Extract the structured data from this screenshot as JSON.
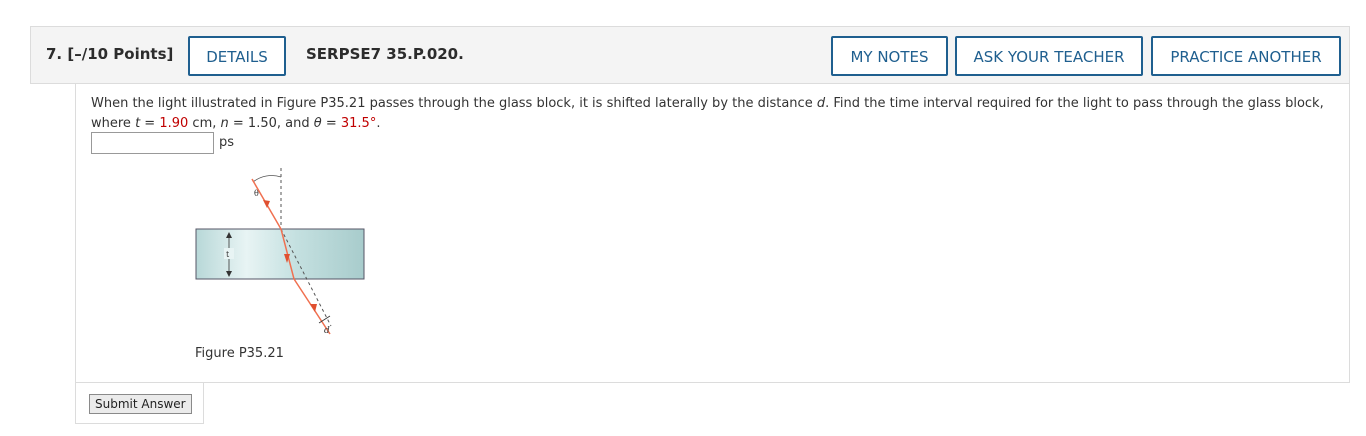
{
  "question": {
    "number": "7.",
    "points": "[–/10 Points]",
    "code": "SERPSE7 35.P.020."
  },
  "buttons": {
    "details": "DETAILS",
    "my_notes": "MY NOTES",
    "ask_teacher": "ASK YOUR TEACHER",
    "practice_another": "PRACTICE ANOTHER",
    "submit": "Submit Answer"
  },
  "body": {
    "text_pre": "When the light illustrated in Figure P35.21 passes through the glass block, it is shifted laterally by the distance ",
    "var_d": "d",
    "text_mid": ". Find the time interval required for the light to pass through the glass block, where ",
    "var_t": "t",
    "eq1": " = ",
    "t_value": "1.90",
    "t_unit": " cm, ",
    "var_n": "n",
    "n_text": " = 1.50, and ",
    "var_theta": "θ",
    "eq2": " = ",
    "theta_value": "31.5°",
    "end": "."
  },
  "answer": {
    "unit": "ps",
    "value": ""
  },
  "figure": {
    "caption": "Figure P35.21",
    "label_theta": "θ",
    "label_t": "t",
    "label_d": "d"
  },
  "colors": {
    "accent": "#1f5f8f",
    "value_red": "#c00000",
    "ray": "#f07050"
  }
}
